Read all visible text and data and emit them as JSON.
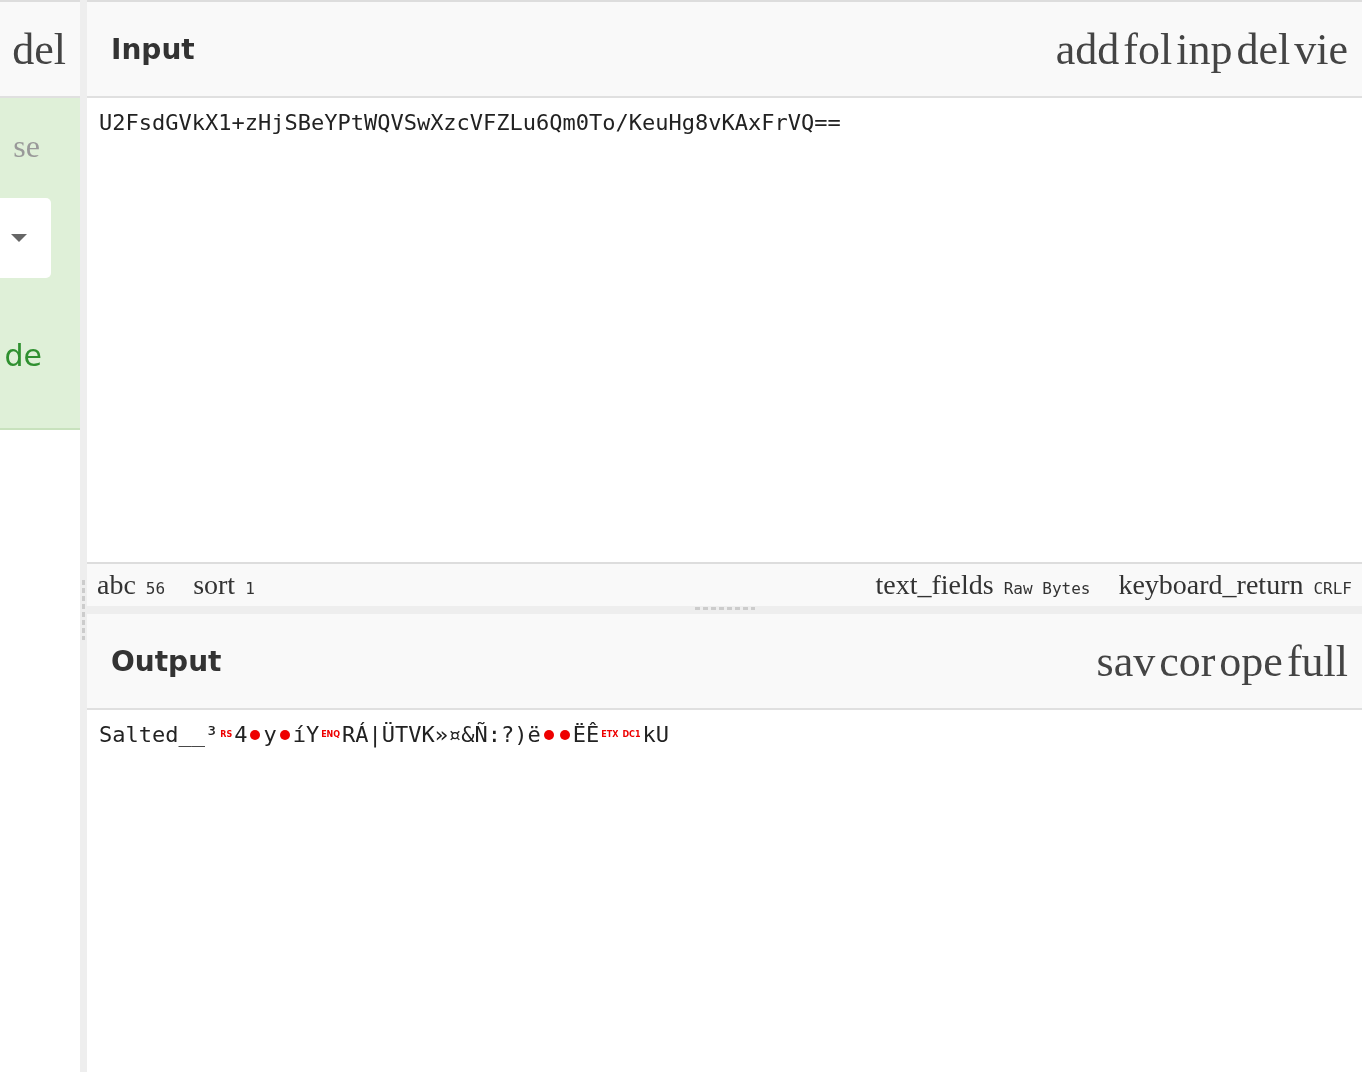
{
  "sidebar": {
    "header_icon": "del",
    "items": [
      {
        "kind": "hint",
        "text": "se"
      },
      {
        "kind": "dropdown"
      },
      {
        "kind": "label",
        "text": "de"
      }
    ]
  },
  "input": {
    "title": "Input",
    "actions": [
      "add",
      "fol",
      "inp",
      "del",
      "vie"
    ],
    "value": "U2FsdGVkX1+zHjSBeYPtWQVSwXzcVFZLu6Qm0To/KeuHg8vKAxFrVQ=="
  },
  "status_bar": {
    "left": [
      {
        "icon": "abc",
        "value": "56"
      },
      {
        "icon": "sort",
        "value": "1"
      }
    ],
    "right": [
      {
        "icon": "text_fields",
        "value": "Raw Bytes"
      },
      {
        "icon": "keyboard_return",
        "value": "CRLF"
      }
    ]
  },
  "output": {
    "title": "Output",
    "actions": [
      "sav",
      "cor",
      "ope",
      "full"
    ],
    "segments": [
      {
        "kind": "text",
        "text": "Salted__³"
      },
      {
        "kind": "control",
        "text": "RS"
      },
      {
        "kind": "text",
        "text": "4"
      },
      {
        "kind": "dot"
      },
      {
        "kind": "text",
        "text": "y"
      },
      {
        "kind": "dot"
      },
      {
        "kind": "text",
        "text": "íY"
      },
      {
        "kind": "control",
        "text": "ENQ"
      },
      {
        "kind": "text",
        "text": "RÁ|ÜTVK»¤&Ñ:?)ë"
      },
      {
        "kind": "dot"
      },
      {
        "kind": "dot"
      },
      {
        "kind": "text",
        "text": "ËÊ"
      },
      {
        "kind": "control",
        "text": "ETX"
      },
      {
        "kind": "control",
        "text": "DC1"
      },
      {
        "kind": "text",
        "text": "kU"
      }
    ]
  }
}
